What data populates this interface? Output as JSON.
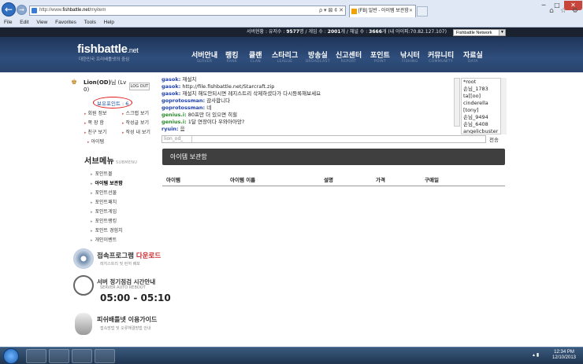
{
  "browser": {
    "address_prefix": "http://www.",
    "address_domain": "fishbattle.net",
    "address_path": "/myitem",
    "tab_title": "[FB] 일반 - 아이템 보관함",
    "menu": [
      "File",
      "Edit",
      "View",
      "Favorites",
      "Tools",
      "Help"
    ],
    "address_tools": "ρ ▾ ⊠ ¢ ✕"
  },
  "topbar": {
    "server_label": "서버현황 :",
    "fish_label": "유저수 :",
    "fish_count": "9577",
    "fish_unit": "명",
    "game_label": "게임 수 :",
    "game_count": "2001",
    "game_unit": "개",
    "channel_label": "채널 수 :",
    "channel_count": "3666",
    "channel_unit": "개",
    "my_ip": "(내 아이피:70.82.127.107)",
    "network_select": "Fishbattle Network"
  },
  "header": {
    "logo_main": "fishbattle",
    "logo_tld": ".net",
    "logo_sub": "대한민국 프리배틀넷의 중심",
    "nav": [
      {
        "ko": "서버안내",
        "en": "SERVER"
      },
      {
        "ko": "랭킹",
        "en": "RANK"
      },
      {
        "ko": "클랜",
        "en": "CLAN"
      },
      {
        "ko": "스타리그",
        "en": "LEAGUE"
      },
      {
        "ko": "방송실",
        "en": "BROADCAST"
      },
      {
        "ko": "신고센터",
        "en": "REPORT"
      },
      {
        "ko": "포인트",
        "en": "POINT"
      },
      {
        "ko": "낚시터",
        "en": "FISHING"
      },
      {
        "ko": "커뮤니티",
        "en": "COMMUNITY"
      },
      {
        "ko": "자료실",
        "en": "DATA"
      }
    ]
  },
  "user": {
    "name": "Lion(OD)",
    "level": "님 (Lv",
    "level_value": "0)",
    "logout": "LOG OUT",
    "points": "보유포인트 : 6",
    "links": [
      "회원 정보",
      "스크랩 보기",
      "쪽 장 함",
      "작성글 보기",
      "친구 보기",
      "작성 내 보기",
      "아이템"
    ]
  },
  "submenu": {
    "title": "서브메뉴",
    "title_en": "SUBMENU",
    "items": [
      "포인트몰",
      "아이템 보관함",
      "포인트선물",
      "포인트패치",
      "포인트게임",
      "포인트랭킹",
      "포인트 경험치",
      "개인이벤트"
    ]
  },
  "banners": [
    {
      "title_a": "접속프로그램 ",
      "title_b": "다운로드",
      "sub": "레지스트리 및 런처 배포"
    },
    {
      "title_a": "서버 정기점검 시간안내",
      "title_b": "",
      "sub": "SERVER AUTO REBOOT",
      "time": "05:00 - 05:10"
    },
    {
      "title_a": "피쉬배틀넷 이용가이드",
      "title_b": "",
      "sub": "접속방법 및 오류해결방법 안내"
    }
  ],
  "chat": {
    "lines": [
      {
        "user": "gasok:",
        "text": " 재설치",
        "green": false
      },
      {
        "user": "gasok:",
        "text": " http://file.fishbattle.net/Starcraft.zip",
        "green": false
      },
      {
        "user": "gasok:",
        "text": " 재설치 해도안되시면 레지스트리 삭제하셨다가 다시등록해보세요",
        "green": false
      },
      {
        "user": "goprotossman:",
        "text": " 감사합니다",
        "green": false
      },
      {
        "user": "goprotossman:",
        "text": " 네",
        "green": false
      },
      {
        "user": "genius.i:",
        "text": " 80프만 더 있으면 히힐",
        "green": true
      },
      {
        "user": "genius.i:",
        "text": " 1달 연장이다 우와아아앙?",
        "green": true
      },
      {
        "user": "ryuin:",
        "text": " 음",
        "green": false
      }
    ],
    "users": [
      "*root",
      "손님_1783",
      "ta[[oo]",
      "cinderella",
      "[tony]",
      "손님_9494",
      "손님_6408",
      "angelicbuster"
    ],
    "input_name": "lion_od_",
    "send": "전송"
  },
  "main": {
    "section_title": "아이템 보관함",
    "columns": [
      "아이템",
      "아이템 이름",
      "설명",
      "가격",
      "구매일"
    ]
  },
  "taskbar": {
    "time": "12:34 PM",
    "date": "12/10/2013"
  }
}
